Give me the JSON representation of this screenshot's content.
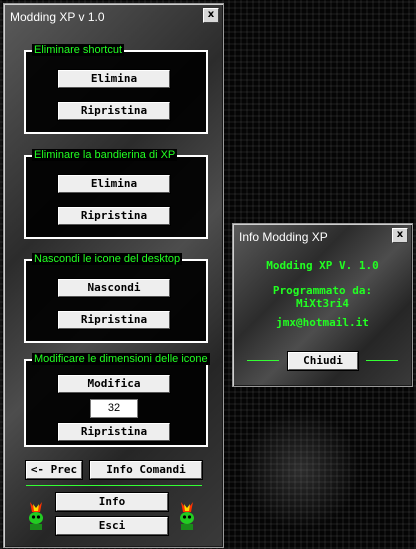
{
  "main_window": {
    "title": "Modding XP v 1.0",
    "close_label": "x",
    "groups": [
      {
        "legend": "Eliminare shortcut",
        "primary_label": "Elimina",
        "secondary_label": "Ripristina"
      },
      {
        "legend": "Eliminare la bandierina di XP",
        "primary_label": "Elimina",
        "secondary_label": "Ripristina"
      },
      {
        "legend": "Nascondi le icone del desktop",
        "primary_label": "Nascondi",
        "secondary_label": "Ripristina"
      },
      {
        "legend": "Modificare le dimensioni delle icone",
        "primary_label": "Modifica",
        "value": "32",
        "secondary_label": "Ripristina"
      }
    ],
    "prev_label": "<- Prec",
    "info_comandi_label": "Info Comandi",
    "info_label": "Info",
    "exit_label": "Esci",
    "accent_color": "#22ff22"
  },
  "info_window": {
    "title": "Info Modding XP",
    "close_label": "x",
    "app_name": "Modding XP V. 1.0",
    "programmed_by_label": "Programmato da:",
    "author": "MiXt3ri4",
    "email": "jmx@hotmail.it",
    "close_button_label": "Chiudi"
  }
}
